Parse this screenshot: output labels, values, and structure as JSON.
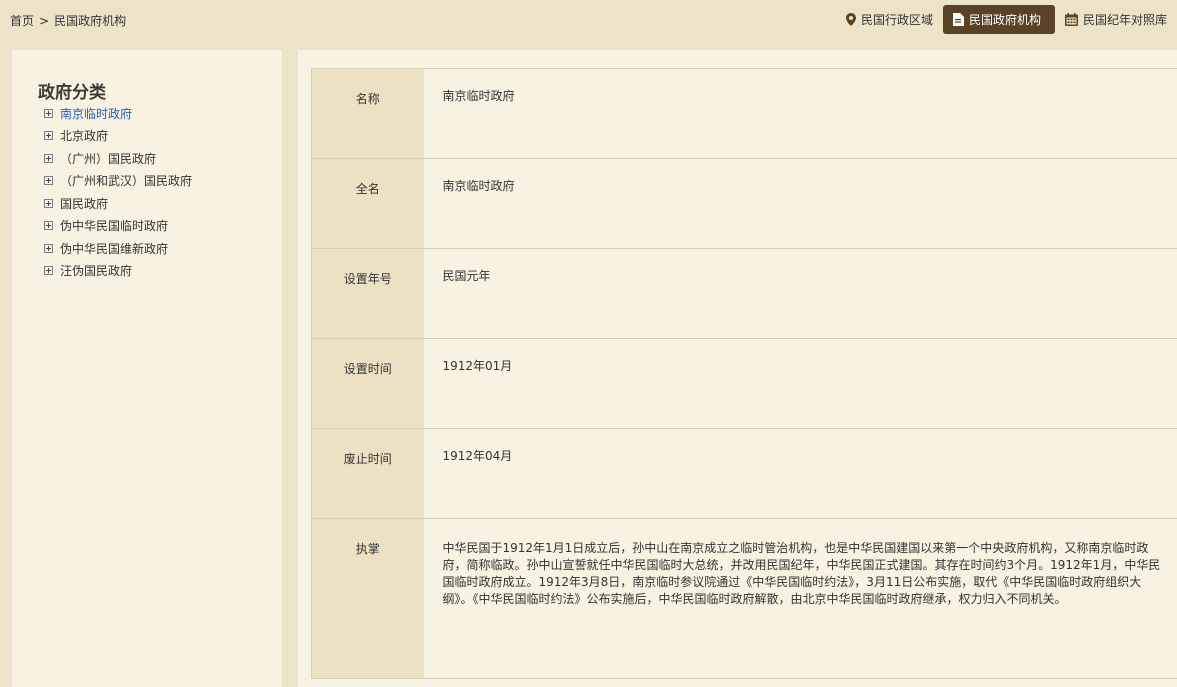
{
  "breadcrumb": {
    "home": "首页",
    "separator": ">",
    "current": "民国政府机构"
  },
  "nav": {
    "items": [
      {
        "label": "民国行政区域",
        "icon": "map-pin-icon",
        "active": false
      },
      {
        "label": "民国政府机构",
        "icon": "document-icon",
        "active": true
      },
      {
        "label": "民国纪年对照库",
        "icon": "calendar-icon",
        "active": false
      }
    ],
    "active_color": "#5a4226"
  },
  "sidebar": {
    "title": "政府分类",
    "items": [
      {
        "label": "南京临时政府",
        "selected": true
      },
      {
        "label": "北京政府",
        "selected": false
      },
      {
        "label": "（广州）国民政府",
        "selected": false
      },
      {
        "label": "（广州和武汉）国民政府",
        "selected": false
      },
      {
        "label": "国民政府",
        "selected": false
      },
      {
        "label": "伪中华民国临时政府",
        "selected": false
      },
      {
        "label": "伪中华民国维新政府",
        "selected": false
      },
      {
        "label": "汪伪国民政府",
        "selected": false
      }
    ],
    "selected_color": "#2a5db0"
  },
  "detail": {
    "rows": [
      {
        "label": "名称",
        "value": "南京临时政府"
      },
      {
        "label": "全名",
        "value": "南京临时政府"
      },
      {
        "label": "设置年号",
        "value": "民国元年"
      },
      {
        "label": "设置时间",
        "value": "1912年01月"
      },
      {
        "label": "废止时间",
        "value": "1912年04月"
      },
      {
        "label": "执掌",
        "value": "中华民国于1912年1月1日成立后，孙中山在南京成立之临时管治机构，也是中华民国建国以来第一个中央政府机构，又称南京临时政府，简称临政。孙中山宣誓就任中华民国临时大总统，并改用民国纪年，中华民国正式建国。其存在时间约3个月。1912年1月，中华民国临时政府成立。1912年3月8日，南京临时参议院通过《中华民国临时约法》，3月11日公布实施，取代《中华民国临时政府组织大纲》。《中华民国临时约法》公布实施后，中华民国临时政府解散，由北京中华民国临时政府继承，权力归入不同机关。"
      }
    ]
  }
}
